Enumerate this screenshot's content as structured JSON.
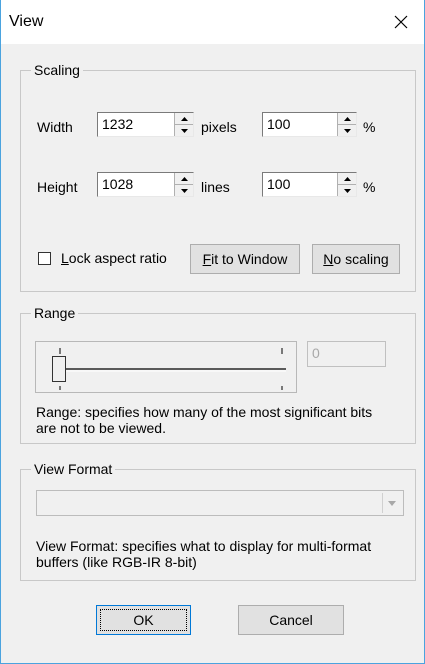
{
  "window": {
    "title": "View",
    "close_icon": "close-icon"
  },
  "scaling": {
    "title": "Scaling",
    "width_label": "Width",
    "width_value": "1232",
    "width_unit": "pixels",
    "width_percent": "100",
    "height_label": "Height",
    "height_value": "1028",
    "height_unit": "lines",
    "height_percent": "100",
    "percent_symbol": "%",
    "lock_mnemonic": "L",
    "lock_label_rest": "ock aspect ratio",
    "lock_checked": false,
    "fit_mnemonic": "F",
    "fit_rest": "it to Window",
    "noscale_mnemonic": "N",
    "noscale_rest": "o scaling"
  },
  "range": {
    "title": "Range",
    "value": "0",
    "slider_position": 0,
    "description": "Range: specifies how many of the most significant bits are not to be viewed."
  },
  "view_format": {
    "title": "View Format",
    "selected": "",
    "description": "View Format: specifies what to display for multi-format buffers (like RGB-IR 8-bit)"
  },
  "buttons": {
    "ok": "OK",
    "cancel": "Cancel"
  }
}
